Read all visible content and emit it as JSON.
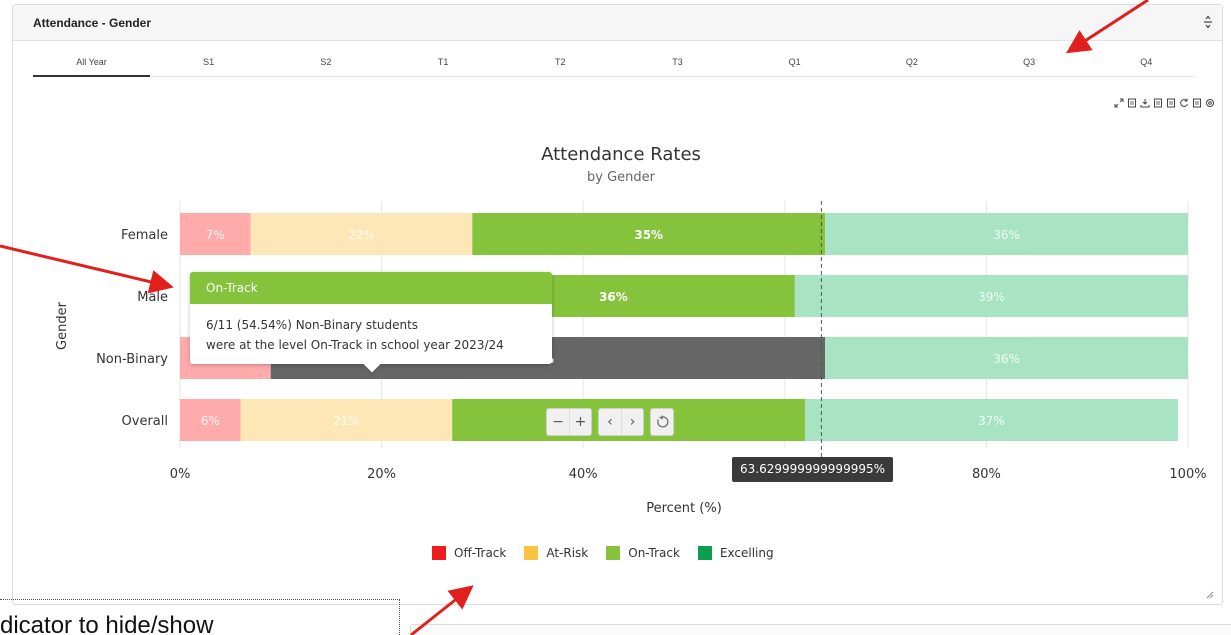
{
  "panel": {
    "title": "Attendance - Gender",
    "collapse_icon": "collapse-updown-icon"
  },
  "tabs": [
    {
      "label": "All Year",
      "active": true
    },
    {
      "label": "S1"
    },
    {
      "label": "S2"
    },
    {
      "label": "T1"
    },
    {
      "label": "T2"
    },
    {
      "label": "T3"
    },
    {
      "label": "Q1"
    },
    {
      "label": "Q2"
    },
    {
      "label": "Q3"
    },
    {
      "label": "Q4"
    }
  ],
  "toolbar_icons": [
    "expand-icon",
    "export-png-icon",
    "download-icon",
    "save-icon",
    "copy-icon",
    "refresh-icon",
    "document-icon",
    "settings-icon"
  ],
  "colors": {
    "off_track": "#ee1c1c",
    "at_risk": "#f9c440",
    "on_track": "#86c33d",
    "excelling": "#0a9e4f",
    "off_track_faded": "#ffabab",
    "at_risk_faded": "#fde7b6",
    "excelling_faded": "#a8e4c4",
    "highlight_gray": "#666666"
  },
  "chart_data": {
    "type": "bar",
    "orientation": "horizontal",
    "stacked": true,
    "title": "Attendance Rates",
    "subtitle": "by Gender",
    "xlabel": "Percent (%)",
    "ylabel": "Gender",
    "xlim": [
      0,
      100
    ],
    "x_ticks": [
      "0%",
      "20%",
      "40%",
      "60%",
      "80%",
      "100%"
    ],
    "categories": [
      "Female",
      "Male",
      "Non-Binary",
      "Overall"
    ],
    "series": [
      {
        "name": "Off-Track",
        "values": [
          7,
          0,
          9,
          6
        ],
        "labels": [
          "7%",
          "",
          "",
          "6%"
        ]
      },
      {
        "name": "At-Risk",
        "values": [
          22,
          0,
          0,
          21
        ],
        "labels": [
          "22%",
          "",
          "",
          "21%"
        ]
      },
      {
        "name": "On-Track",
        "values": [
          35,
          36,
          55,
          35
        ],
        "labels": [
          "35%",
          "36%",
          "%",
          ""
        ]
      },
      {
        "name": "Excelling",
        "values": [
          36,
          39,
          36,
          37
        ],
        "labels": [
          "36%",
          "39%",
          "36%",
          "37%"
        ]
      }
    ],
    "male_on_track_start": 25,
    "crosshair_value": "63.629999999999995%",
    "grid": true,
    "legend_position": "bottom"
  },
  "tooltip": {
    "title": "On-Track",
    "line1": "6/11 (54.54%) Non-Binary students",
    "line2": "were at the level On-Track in school year 2023/24"
  },
  "zoom_controls": {
    "minus": "−",
    "plus": "+",
    "prev": "‹",
    "next": "›"
  },
  "caption": "dicator to hide/show"
}
